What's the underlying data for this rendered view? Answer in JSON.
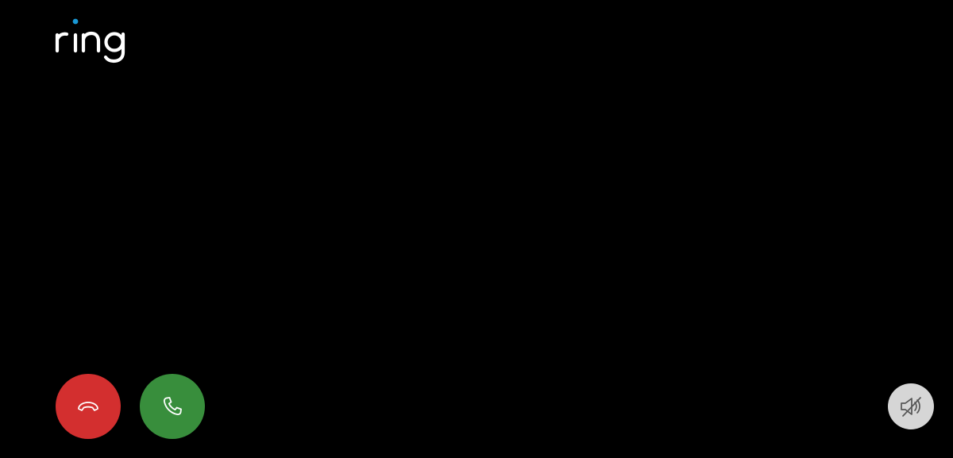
{
  "brand": {
    "name": "ring",
    "text_color": "#ffffff",
    "dot_color": "#1998d5"
  },
  "controls": {
    "decline": {
      "icon": "phone-hangup-icon",
      "color": "#d32f2f"
    },
    "accept": {
      "icon": "phone-icon",
      "color": "#388e3c"
    },
    "mute": {
      "icon": "speaker-muted-icon",
      "color": "#d6d6d6"
    }
  }
}
